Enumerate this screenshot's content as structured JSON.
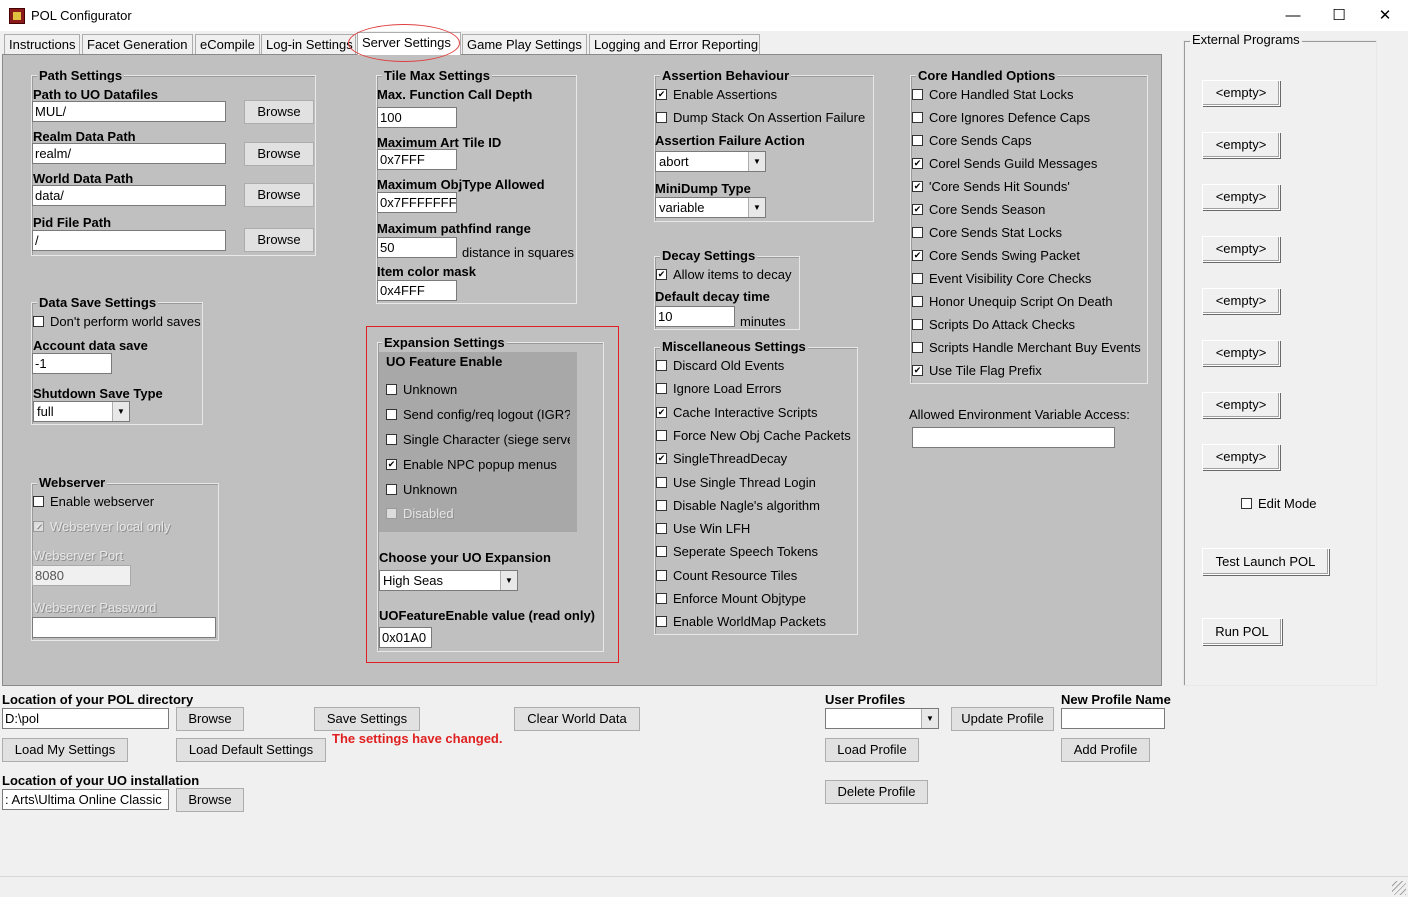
{
  "window": {
    "title": "POL Configurator",
    "minimize": "—",
    "maximize": "☐",
    "close": "✕"
  },
  "tabs": [
    "Instructions",
    "Facet Generation",
    "eCompile",
    "Log-in Settings",
    "Server Settings",
    "Game Play Settings",
    "Logging and Error Reporting"
  ],
  "active_tab": "Server Settings",
  "path_settings": {
    "title": "Path Settings",
    "uo_datafiles_label": "Path to UO Datafiles",
    "uo_datafiles_value": "MUL/",
    "realm_label": "Realm Data Path",
    "realm_value": "realm/",
    "world_label": "World Data Path",
    "world_value": "data/",
    "pid_label": "Pid File Path",
    "pid_value": "/",
    "browse": "Browse"
  },
  "data_save": {
    "title": "Data Save Settings",
    "dont_save": "Don't perform world saves",
    "dont_save_checked": false,
    "account_label": "Account data save",
    "account_value": "-1",
    "shutdown_label": "Shutdown Save Type",
    "shutdown_value": "full"
  },
  "webserver": {
    "title": "Webserver",
    "enable": "Enable webserver",
    "enable_checked": false,
    "local_only": "Webserver local only",
    "local_only_checked": true,
    "port_label": "Webserver Port",
    "port_value": "8080",
    "password_label": "Webserver Password",
    "password_value": ""
  },
  "tile_max": {
    "title": "Tile Max Settings",
    "call_depth_label": "Max. Function Call Depth",
    "call_depth_value": "100",
    "art_tile_label": "Maximum Art Tile ID",
    "art_tile_value": "0x7FFF",
    "objtype_label": "Maximum ObjType Allowed",
    "objtype_value": "0x7FFFFFFF",
    "pathfind_label": "Maximum pathfind range",
    "pathfind_value": "50",
    "pathfind_unit": "distance in squares",
    "color_mask_label": "Item color mask",
    "color_mask_value": "0x4FFF"
  },
  "expansion": {
    "title": "Expansion Settings",
    "feature_title": "UO Feature Enable",
    "features": [
      {
        "label": "Unknown",
        "checked": false,
        "disabled": false
      },
      {
        "label": "Send config/req logout (IGR?",
        "checked": false,
        "disabled": false
      },
      {
        "label": "Single Character (siege serve",
        "checked": false,
        "disabled": false
      },
      {
        "label": "Enable NPC popup menus",
        "checked": true,
        "disabled": false
      },
      {
        "label": "Unknown",
        "checked": false,
        "disabled": false
      },
      {
        "label": "Disabled",
        "checked": false,
        "disabled": true
      }
    ],
    "choose_label": "Choose your UO Expansion",
    "choose_value": "High Seas",
    "value_label": "UOFeatureEnable value (read only)",
    "value_value": "0x01A0"
  },
  "assertion": {
    "title": "Assertion Behaviour",
    "enable": "Enable Assertions",
    "enable_checked": true,
    "dump": "Dump Stack On Assertion Failure",
    "dump_checked": false,
    "action_label": "Assertion Failure Action",
    "action_value": "abort",
    "minidump_label": "MiniDump Type",
    "minidump_value": "variable"
  },
  "decay": {
    "title": "Decay Settings",
    "allow": "Allow items to decay",
    "allow_checked": true,
    "time_label": "Default decay time",
    "time_value": "10",
    "time_unit": "minutes"
  },
  "misc": {
    "title": "Miscellaneous Settings",
    "items": [
      {
        "label": "Discard Old Events",
        "checked": false
      },
      {
        "label": "Ignore Load Errors",
        "checked": false
      },
      {
        "label": "Cache Interactive Scripts",
        "checked": true
      },
      {
        "label": "Force New Obj Cache Packets",
        "checked": false
      },
      {
        "label": "SingleThreadDecay",
        "checked": true
      },
      {
        "label": "Use Single Thread Login",
        "checked": false
      },
      {
        "label": "Disable Nagle's algorithm",
        "checked": false
      },
      {
        "label": "Use Win LFH",
        "checked": false
      },
      {
        "label": "Seperate Speech Tokens",
        "checked": false
      },
      {
        "label": "Count Resource Tiles",
        "checked": false
      },
      {
        "label": "Enforce Mount Objtype",
        "checked": false
      },
      {
        "label": "Enable WorldMap Packets",
        "checked": false
      }
    ]
  },
  "core_handled": {
    "title": "Core Handled Options",
    "items": [
      {
        "label": "Core Handled Stat Locks",
        "checked": false
      },
      {
        "label": "Core Ignores Defence Caps",
        "checked": false
      },
      {
        "label": "Core Sends Caps",
        "checked": false
      },
      {
        "label": "Corel Sends Guild Messages",
        "checked": true
      },
      {
        "label": "'Core Sends Hit Sounds'",
        "checked": true
      },
      {
        "label": "Core Sends Season",
        "checked": true
      },
      {
        "label": "Core Sends Stat Locks",
        "checked": false
      },
      {
        "label": "Core Sends Swing Packet",
        "checked": true
      },
      {
        "label": "Event Visibility Core Checks",
        "checked": false
      },
      {
        "label": "Honor Unequip Script On Death",
        "checked": false
      },
      {
        "label": "Scripts Do Attack Checks",
        "checked": false
      },
      {
        "label": "Scripts Handle Merchant Buy Events",
        "checked": false
      },
      {
        "label": "Use Tile Flag Prefix",
        "checked": true
      }
    ],
    "env_label": "Allowed Environment Variable Access:",
    "env_value": ""
  },
  "external": {
    "title": "External Programs",
    "slots": [
      "<empty>",
      "<empty>",
      "<empty>",
      "<empty>",
      "<empty>",
      "<empty>",
      "<empty>",
      "<empty>"
    ],
    "edit_mode": "Edit Mode",
    "edit_mode_checked": false,
    "test_launch": "Test Launch POL",
    "run": "Run POL"
  },
  "bottom": {
    "pol_dir_label": "Location of your POL directory",
    "pol_dir_value": "D:\\pol",
    "browse": "Browse",
    "save_settings": "Save Settings",
    "changed_msg": "The settings have changed.",
    "clear_world": "Clear World Data",
    "load_my": "Load My Settings",
    "load_default": "Load Default Settings",
    "uo_install_label": "Location of your UO installation",
    "uo_install_value": ": Arts\\Ultima Online Classic",
    "profiles_label": "User Profiles",
    "profiles_value": "",
    "update_profile": "Update Profile",
    "new_profile_label": "New Profile Name",
    "new_profile_value": "",
    "load_profile": "Load Profile",
    "add_profile": "Add Profile",
    "delete_profile": "Delete Profile",
    "changed_color": "#e02020"
  }
}
